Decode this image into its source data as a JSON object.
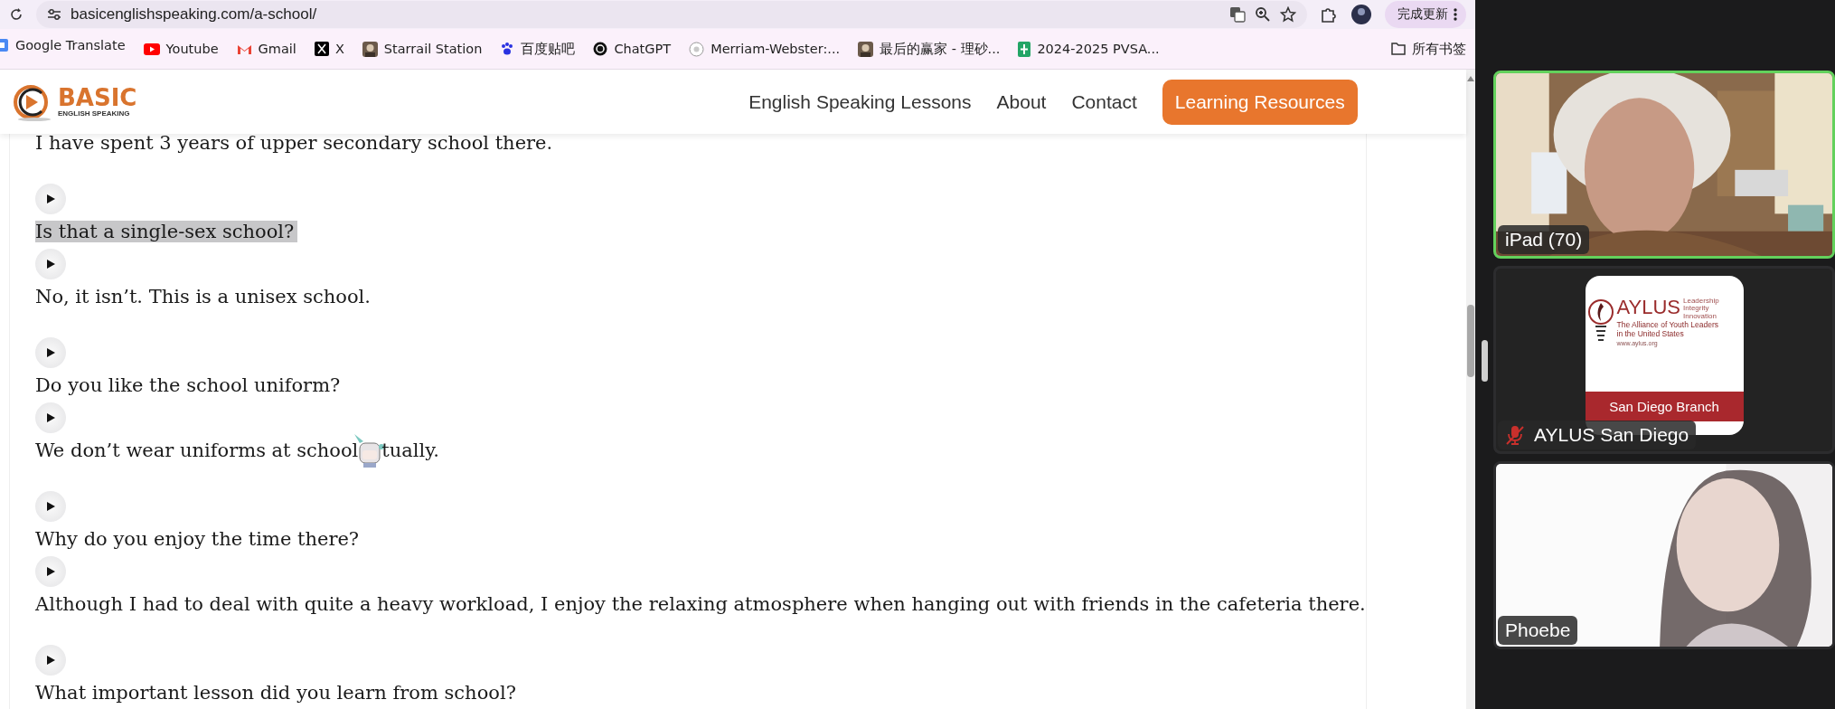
{
  "browser": {
    "url": "basicenglishspeaking.com/a-school/",
    "update_button": "完成更新"
  },
  "bookmarks": [
    {
      "label": "Google Translate",
      "kind": "translate"
    },
    {
      "label": "Youtube",
      "kind": "youtube"
    },
    {
      "label": "Gmail",
      "kind": "gmail"
    },
    {
      "label": "X",
      "kind": "x"
    },
    {
      "label": "Starrail Station",
      "kind": "avatar"
    },
    {
      "label": "百度贴吧",
      "kind": "paw"
    },
    {
      "label": "ChatGPT",
      "kind": "chatgpt"
    },
    {
      "label": "Merriam-Webster:...",
      "kind": "mw"
    },
    {
      "label": "最后的赢家 - 理砂...",
      "kind": "avatar"
    },
    {
      "label": "2024-2025 PVSA...",
      "kind": "sheet"
    }
  ],
  "all_bookmarks": "所有书签",
  "site": {
    "logo_title": "BASIC",
    "logo_subtitle": "ENGLISH SPEAKING",
    "nav": [
      {
        "label": "English Speaking Lessons",
        "kind": "link"
      },
      {
        "label": "About",
        "kind": "link"
      },
      {
        "label": "Contact",
        "kind": "link"
      },
      {
        "label": "Learning Resources",
        "kind": "cta"
      }
    ]
  },
  "content": {
    "first_line": "I have spent 3 years of upper secondary school there.",
    "pairs": [
      {
        "question": {
          "text": "Is that a single-sex school?",
          "highlighted": true
        },
        "answer": {
          "text": "No, it isn’t. This is a unisex school.",
          "highlighted": false
        }
      },
      {
        "question": {
          "text": "Do you like the school uniform?",
          "highlighted": false
        },
        "answer": {
          "text": "We don’t wear uniforms at school",
          "text_after_cursor": "tually.",
          "highlighted": false
        }
      },
      {
        "question": {
          "text": "Why do you enjoy the time there?",
          "highlighted": false
        },
        "answer": {
          "text": "Although I had to deal with quite a heavy workload, I enjoy the relaxing atmosphere when hanging out with friends in the cafeteria there.",
          "highlighted": false
        }
      },
      {
        "question": {
          "text": "What important lesson did you learn from school?",
          "highlighted": false
        }
      }
    ]
  },
  "participants": [
    {
      "name": "iPad (70)",
      "kind": "video",
      "speaking": true,
      "muted": false
    },
    {
      "name": "AYLUS San Diego",
      "kind": "logo",
      "speaking": false,
      "muted": true,
      "logo": {
        "title": "AYLUS",
        "tags": [
          "Leadership",
          "Integrity",
          "Innovation"
        ],
        "lines": [
          "The Alliance of Youth Leaders",
          "in the United States"
        ],
        "url": "www.aylus.org",
        "band": "San Diego Branch"
      }
    },
    {
      "name": "Phoebe",
      "kind": "video_light",
      "speaking": false,
      "muted": false
    }
  ]
}
